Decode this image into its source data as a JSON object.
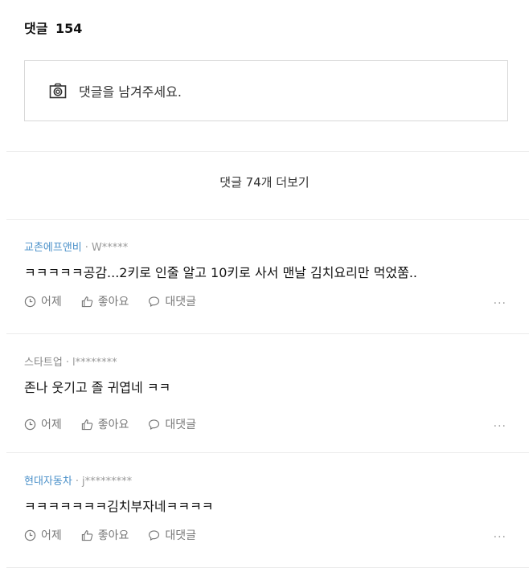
{
  "header": {
    "title": "댓글",
    "count": "154"
  },
  "input": {
    "placeholder": "댓글을 남겨주세요.",
    "icon": "camera-icon"
  },
  "more_comments": "댓글 74개 더보기",
  "comments": [
    {
      "company": "교촌에프앤비",
      "author": "W*****",
      "text": "ㅋㅋㅋㅋㅋ공감...2키로 인줄 알고 10키로 사서 맨날 김치요리만 먹었쭘..",
      "time": "어제",
      "like_label": "좋아요",
      "reply_label": "대댓글",
      "more": "..."
    },
    {
      "company": "스타트업",
      "author": "l********",
      "text": "존나 웃기고 졸 귀엽네 ㅋㅋ",
      "time": "어제",
      "like_label": "좋아요",
      "reply_label": "대댓글",
      "more": "..."
    },
    {
      "company": "현대자동차",
      "author": "j*********",
      "text": "ㅋㅋㅋㅋㅋㅋㅋ김치부자네ㅋㅋㅋㅋ",
      "time": "어제",
      "like_label": "좋아요",
      "reply_label": "대댓글",
      "more": "..."
    }
  ],
  "colors": {
    "company_link": "#4a90c9",
    "meta_gray": "#999999",
    "divider": "#ececec",
    "border": "#d8d8d8"
  }
}
